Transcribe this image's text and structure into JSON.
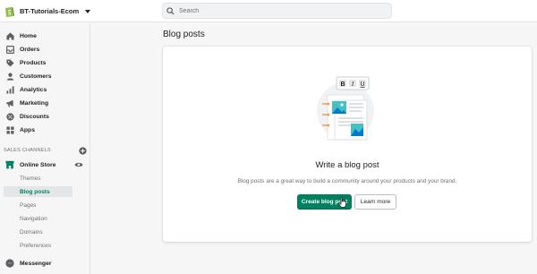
{
  "topbar": {
    "store_name": "BT-Tutorials-Ecom",
    "search_placeholder": "Search"
  },
  "sidebar": {
    "items": [
      {
        "label": "Home",
        "icon": "home-icon"
      },
      {
        "label": "Orders",
        "icon": "orders-icon"
      },
      {
        "label": "Products",
        "icon": "tag-icon"
      },
      {
        "label": "Customers",
        "icon": "customer-icon"
      },
      {
        "label": "Analytics",
        "icon": "analytics-icon"
      },
      {
        "label": "Marketing",
        "icon": "megaphone-icon"
      },
      {
        "label": "Discounts",
        "icon": "discount-icon"
      },
      {
        "label": "Apps",
        "icon": "apps-icon"
      }
    ],
    "sales_channels_label": "SALES CHANNELS",
    "online_store_label": "Online Store",
    "online_store_sub": [
      "Themes",
      "Blog posts",
      "Pages",
      "Navigation",
      "Domains",
      "Preferences"
    ],
    "active_sub": "Blog posts",
    "messenger_label": "Messenger"
  },
  "main": {
    "title": "Blog posts",
    "empty_state": {
      "heading": "Write a blog post",
      "body": "Blog posts are a great way to build a community around your products and your brand.",
      "primary_button": "Create blog post",
      "secondary_button": "Learn more",
      "toolbar_glyphs": [
        "B",
        "I",
        "U"
      ]
    }
  },
  "colors": {
    "accent": "#008060",
    "active_text": "#007f5f",
    "surface": "#ffffff",
    "background": "#f6f6f7"
  }
}
